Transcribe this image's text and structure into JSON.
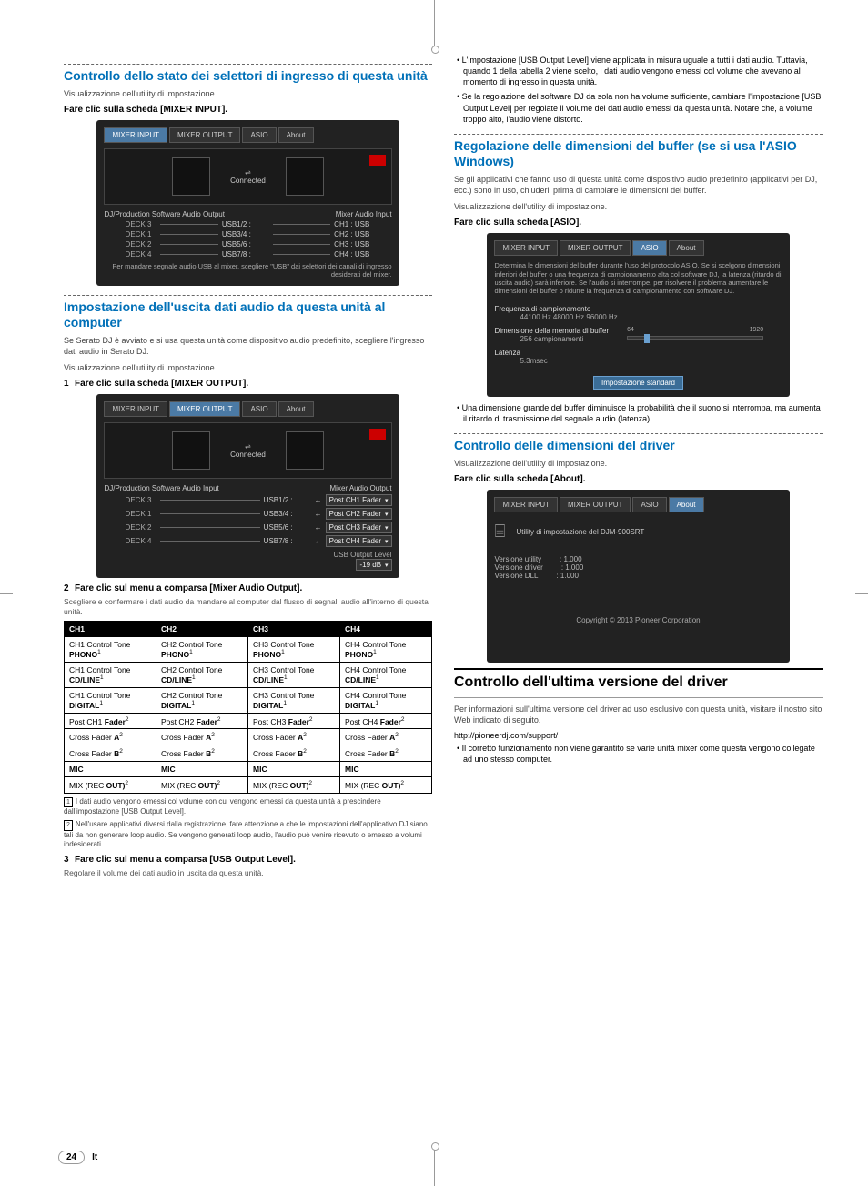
{
  "left": {
    "sep_above": true,
    "sec1": {
      "title": "Controllo dello stato dei selettori di ingresso di questa unità",
      "intro": "Visualizzazione dell'utility di impostazione.",
      "step": "Fare clic sulla scheda [MIXER INPUT].",
      "panel": {
        "tabs": [
          "MIXER INPUT",
          "MIXER OUTPUT",
          "ASIO",
          "About"
        ],
        "activeTab": 0,
        "connected": "Connected",
        "leftHeader": "DJ/Production Software Audio Output",
        "rightHeader": "Mixer Audio Input",
        "rows": [
          {
            "deck": "DECK 3",
            "usb": "USB1/2 :",
            "ch": "CH1 : USB"
          },
          {
            "deck": "DECK 1",
            "usb": "USB3/4 :",
            "ch": "CH2 : USB"
          },
          {
            "deck": "DECK 2",
            "usb": "USB5/6 :",
            "ch": "CH3 : USB"
          },
          {
            "deck": "DECK 4",
            "usb": "USB7/8 :",
            "ch": "CH4 : USB"
          }
        ],
        "note": "Per mandare segnale audio USB al mixer, scegliere \"USB\" dai selettori dei canali di ingresso desiderati del mixer."
      }
    },
    "sec2": {
      "title": "Impostazione dell'uscita dati audio da questa unità al computer",
      "intro1": "Se Serato DJ è avviato e si usa questa unità come dispositivo audio predefinito, scegliere l'ingresso dati audio in Serato DJ.",
      "intro2": "Visualizzazione dell'utility di impostazione.",
      "step1": "Fare clic sulla scheda [MIXER OUTPUT].",
      "panel": {
        "tabs": [
          "MIXER INPUT",
          "MIXER OUTPUT",
          "ASIO",
          "About"
        ],
        "activeTab": 1,
        "connected": "Connected",
        "leftHeader": "DJ/Production Software Audio Input",
        "rightHeader": "Mixer Audio Output",
        "rows": [
          {
            "deck": "DECK 3",
            "usb": "USB1/2 :",
            "sel": "Post CH1 Fader"
          },
          {
            "deck": "DECK 1",
            "usb": "USB3/4 :",
            "sel": "Post CH2 Fader"
          },
          {
            "deck": "DECK 2",
            "usb": "USB5/6 :",
            "sel": "Post CH3 Fader"
          },
          {
            "deck": "DECK 4",
            "usb": "USB7/8 :",
            "sel": "Post CH4 Fader"
          }
        ],
        "outLabel": "USB Output Level",
        "outVal": "-19 dB"
      },
      "step2": "Fare clic sul menu a comparsa [Mixer Audio Output].",
      "hint2": "Scegliere e confermare i dati audio da mandare al computer dal flusso di segnali audio all'interno di questa unità.",
      "table": {
        "headers": [
          "CH1",
          "CH2",
          "CH3",
          "CH4"
        ],
        "rows": [
          [
            "CH1 Control Tone PHONO",
            "CH2 Control Tone PHONO",
            "CH3 Control Tone PHONO",
            "CH4 Control Tone PHONO"
          ],
          [
            "CH1 Control Tone CD/LINE",
            "CH2 Control Tone CD/LINE",
            "CH3 Control Tone CD/LINE",
            "CH4 Control Tone CD/LINE"
          ],
          [
            "CH1 Control Tone DIGITAL",
            "CH2 Control Tone DIGITAL",
            "CH3 Control Tone DIGITAL",
            "CH4 Control Tone DIGITAL"
          ],
          [
            "Post CH1 Fader",
            "Post CH2 Fader",
            "Post CH3 Fader",
            "Post CH4 Fader"
          ],
          [
            "Cross Fader A",
            "Cross Fader A",
            "Cross Fader A",
            "Cross Fader A"
          ],
          [
            "Cross Fader B",
            "Cross Fader B",
            "Cross Fader B",
            "Cross Fader B"
          ],
          [
            "MIC",
            "MIC",
            "MIC",
            "MIC"
          ],
          [
            "MIX (REC OUT)",
            "MIX (REC OUT)",
            "MIX (REC OUT)",
            "MIX (REC OUT)"
          ]
        ],
        "supRows": {
          "0": "1",
          "1": "1",
          "2": "1",
          "3": "2",
          "4": "2",
          "5": "2",
          "7": "2"
        }
      },
      "foot1n": "1",
      "foot1": "I dati audio vengono emessi col volume con cui vengono emessi da questa unità a prescindere dall'impostazione [USB Output Level].",
      "foot2n": "2",
      "foot2": "Nell'usare applicativi diversi dalla registrazione, fare attenzione a che le impostazioni dell'applicativo DJ siano tali da non generare loop audio. Se vengono generati loop audio, l'audio può venire ricevuto o emesso a volumi indesiderati.",
      "step3": "Fare clic sul menu a comparsa [USB Output Level].",
      "hint3": "Regolare il volume dei dati audio in uscita da questa unità."
    }
  },
  "right": {
    "bullets_top": [
      "L'impostazione [USB Output Level] viene applicata in misura uguale a tutti i dati audio. Tuttavia, quando 1 della tabella 2 viene scelto, i dati audio vengono emessi col volume che avevano al momento di ingresso in questa unità.",
      "Se la regolazione del software DJ da sola non ha volume sufficiente, cambiare l'impostazione [USB Output Level] per regolate il volume dei dati audio emessi da questa unità. Notare che, a volume troppo alto, l'audio viene distorto."
    ],
    "sec3": {
      "title": "Regolazione delle dimensioni del buffer (se si usa l'ASIO Windows)",
      "intro1": "Se gli applicativi che fanno uso di questa unità come dispositivo audio predefinito (applicativi per DJ, ecc.) sono in uso, chiuderli prima di cambiare le dimensioni del buffer.",
      "intro2": "Visualizzazione dell'utility di impostazione.",
      "step": "Fare clic sulla scheda [ASIO].",
      "panel": {
        "tabs": [
          "MIXER INPUT",
          "MIXER OUTPUT",
          "ASIO",
          "About"
        ],
        "activeTab": 2,
        "desc": "Determina le dimensioni del buffer durante l'uso del protocolo ASIO.\nSe si scelgono dimensioni inferiori del buffer o una frequenza di campionamento alta col software DJ, la latenza (ritardo di uscita audio) sarà inferiore.\nSe l'audio si interrompe, per risolvere il problema aumentare le dimensioni del buffer o ridurre la frequenza di campionamento con software DJ.",
        "freqLabel": "Frequenza di campionamento",
        "freqVal": "44100 Hz  48000 Hz  96000 Hz",
        "bufLabel": "Dimensione della memoria di buffer",
        "bufVal": "256 campionamenti",
        "bufLow": "64",
        "bufHigh": "1920",
        "latLabel": "Latenza",
        "latVal": "5.3msec",
        "btn": "Impostazione standard"
      },
      "bullet": "Una dimensione grande del buffer diminuisce la probabilità che il suono si interrompa, ma aumenta il ritardo di trasmissione del segnale audio (latenza)."
    },
    "sec4": {
      "title": "Controllo delle dimensioni del driver",
      "intro": "Visualizzazione dell'utility di impostazione.",
      "step": "Fare clic sulla scheda [About].",
      "panel": {
        "tabs": [
          "MIXER INPUT",
          "MIXER OUTPUT",
          "ASIO",
          "About"
        ],
        "activeTab": 3,
        "prod": "Utility di impostazione del DJM-900SRT",
        "lines": [
          {
            "k": "Versione utility",
            "v": ": 1.000"
          },
          {
            "k": "Versione driver",
            "v": ": 1.000"
          },
          {
            "k": "Versione DLL",
            "v": ": 1.000"
          }
        ],
        "copy": "Copyright © 2013 Pioneer Corporation"
      }
    },
    "sec5": {
      "title": "Controllo dell'ultima versione del driver",
      "intro": "Per informazioni sull'ultima versione del driver ad uso esclusivo con questa unità, visitare il nostro sito Web indicato di seguito.",
      "url": "http://pioneerdj.com/support/",
      "bullet": "Il corretto funzionamento non viene garantito se varie unità mixer come questa vengono collegate ad uno stesso computer."
    }
  },
  "page": {
    "num": "24",
    "lang": "It"
  }
}
